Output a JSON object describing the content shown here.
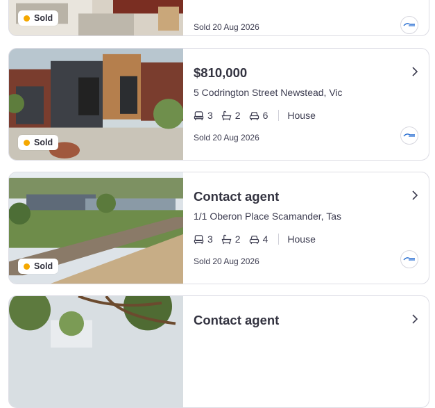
{
  "listings": [
    {
      "price": "",
      "address": "",
      "beds": "",
      "baths": "",
      "cars": "",
      "property_type": "",
      "status": "Sold",
      "sold_date": "Sold 20 Aug 2026",
      "photo_icon": "living-room-photo"
    },
    {
      "price": "$810,000",
      "address": "5 Codrington Street Newstead, Vic",
      "beds": "3",
      "baths": "2",
      "cars": "6",
      "property_type": "House",
      "status": "Sold",
      "sold_date": "Sold 20 Aug 2026",
      "photo_icon": "brick-house-photo"
    },
    {
      "price": "Contact agent",
      "address": "1/1 Oberon Place Scamander, Tas",
      "beds": "3",
      "baths": "2",
      "cars": "4",
      "property_type": "House",
      "status": "Sold",
      "sold_date": "Sold 20 Aug 2026",
      "photo_icon": "coastal-house-photo"
    },
    {
      "price": "Contact agent",
      "address": "",
      "status": "",
      "photo_icon": "tree-house-photo"
    }
  ],
  "colors": {
    "sold_dot": "#f5a800",
    "card_border": "#dcdce4",
    "text": "#3b3b4f"
  },
  "icons": {
    "bed": "bed-icon",
    "bath": "bath-icon",
    "car": "car-icon",
    "chevron": "chevron-right-icon",
    "agency": "agency-logo-icon"
  }
}
